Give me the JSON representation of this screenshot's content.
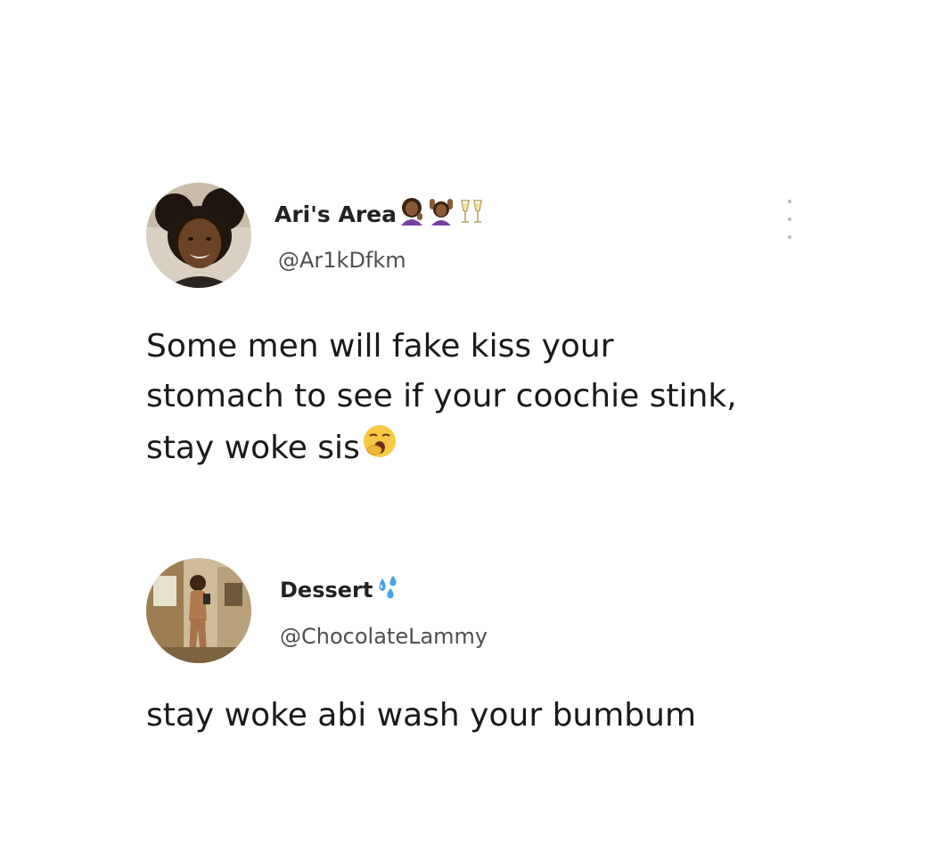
{
  "tweets": [
    {
      "display_name": "Ari's Area",
      "name_emojis": [
        "woman-tipping-hand-icon",
        "woman-raising-hands-icon",
        "clinking-glasses-icon"
      ],
      "handle": "@Ar1kDfkm",
      "text_lines": [
        "Some men will fake kiss your",
        "stomach to see if your coochie stink,",
        "stay woke sis"
      ],
      "text_emoji": "yawning-face-icon",
      "more_menu": "more-options-icon"
    },
    {
      "display_name": "Dessert",
      "name_emojis": [
        "sweat-droplets-icon"
      ],
      "handle": "@ChocolateLammy",
      "text_lines": [
        "stay woke abi wash your bumbum"
      ]
    }
  ],
  "colors": {
    "background": "#ffffff",
    "text": "#1a1a1a",
    "handle": "#4f4f4f",
    "menu_dots": "#b8b8b8"
  }
}
